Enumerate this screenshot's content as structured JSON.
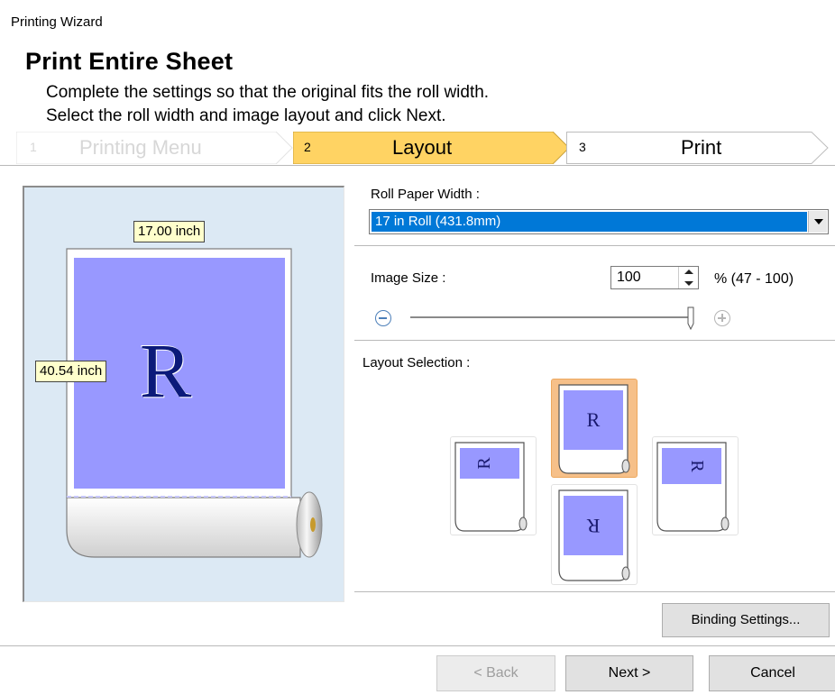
{
  "window": {
    "title": "Printing Wizard"
  },
  "header": {
    "title": "Print Entire Sheet",
    "description_line1": "Complete the settings so that the original fits the roll width.",
    "description_line2": "Select the roll width and image layout and click Next."
  },
  "steps": [
    {
      "number": "1",
      "label": "Printing Menu",
      "state": "done"
    },
    {
      "number": "2",
      "label": "Layout",
      "state": "current"
    },
    {
      "number": "3",
      "label": "Print",
      "state": "upcoming"
    }
  ],
  "preview": {
    "width_label": "17.00 inch",
    "height_label": "40.54 inch",
    "page_letter": "R"
  },
  "roll_paper": {
    "label": "Roll Paper Width :",
    "selected": "17 in Roll (431.8mm)"
  },
  "image_size": {
    "label": "Image Size :",
    "value": "100",
    "range_text": "% (47 - 100)",
    "slider_min": 47,
    "slider_max": 100,
    "slider_value": 100
  },
  "layout_selection": {
    "label": "Layout Selection :",
    "options": [
      {
        "id": "top",
        "rotation": "upright",
        "selected": true
      },
      {
        "id": "left",
        "rotation": "rotated-left",
        "selected": false
      },
      {
        "id": "right",
        "rotation": "rotated-right",
        "selected": false
      },
      {
        "id": "bottom",
        "rotation": "upside-down",
        "selected": false
      }
    ]
  },
  "buttons": {
    "binding_settings": "Binding Settings...",
    "back": "< Back",
    "next": "Next >",
    "cancel": "Cancel"
  },
  "colors": {
    "accent": "#0078d7",
    "step_current": "#ffd363",
    "page_fill": "#9898ff",
    "preview_bg": "#dce9f4",
    "selected_tile": "#f6c089"
  }
}
